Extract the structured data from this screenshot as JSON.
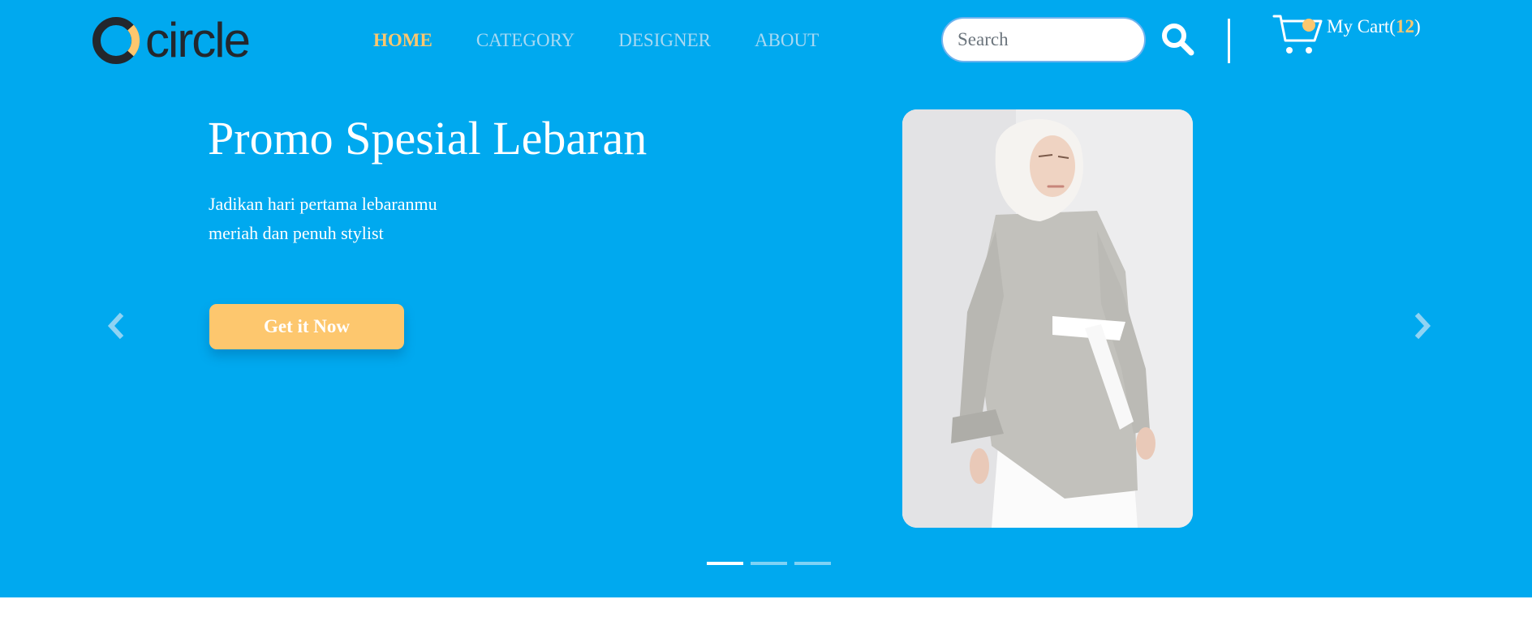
{
  "brand": {
    "name": "circle"
  },
  "nav": {
    "items": [
      {
        "label": "HOME",
        "active": true
      },
      {
        "label": "CATEGORY",
        "active": false
      },
      {
        "label": "DESIGNER",
        "active": false
      },
      {
        "label": "ABOUT",
        "active": false
      }
    ]
  },
  "search": {
    "placeholder": "Search",
    "value": ""
  },
  "cart": {
    "label": "My Cart(",
    "count": "12",
    "close": ")"
  },
  "hero": {
    "title": "Promo Spesial Lebaran",
    "subtitle_line1": "Jadikan hari pertama lebaranmu",
    "subtitle_line2": "meriah dan penuh stylist",
    "cta_label": "Get it Now",
    "slide_count": 3,
    "active_slide": 1
  },
  "icons": {
    "logo": "circle-logo-icon",
    "search": "search-icon",
    "cart": "cart-icon",
    "prev": "chevron-left-icon",
    "next": "chevron-right-icon"
  },
  "colors": {
    "hero_background": "#00a9ef",
    "accent": "#fdc76e",
    "nav_inactive": "#a9d9f2",
    "logo_dark": "#23272d",
    "text_light": "#ffffff"
  }
}
